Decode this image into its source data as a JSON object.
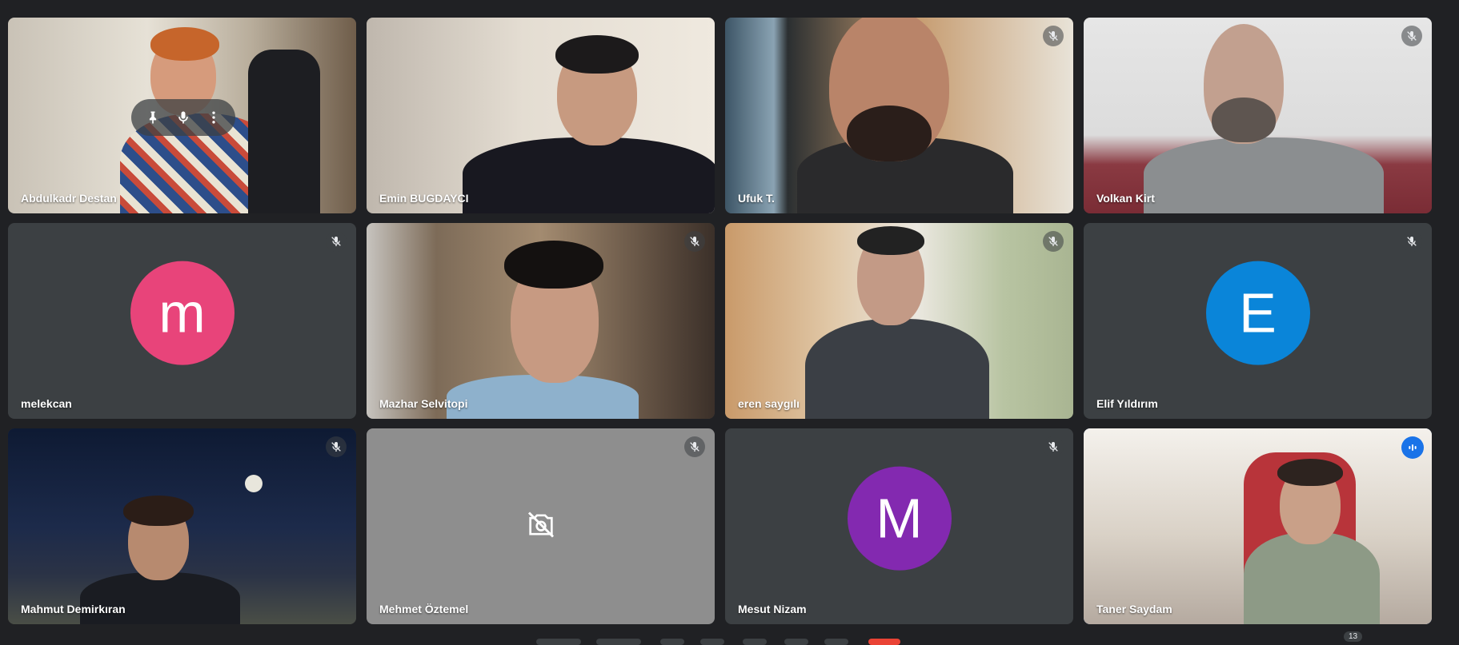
{
  "participants": [
    {
      "name": "Abdulkadr Destan"
    },
    {
      "name": "Emin BUGDAYCI"
    },
    {
      "name": "Ufuk T."
    },
    {
      "name": "Volkan Kirt"
    },
    {
      "name": "melekcan",
      "initial": "m",
      "color": "#e8447a"
    },
    {
      "name": "Mazhar Selvitopi"
    },
    {
      "name": "eren saygılı"
    },
    {
      "name": "Elif Yıldırım",
      "initial": "E",
      "color": "#0a85d9"
    },
    {
      "name": "Mahmut Demirkıran"
    },
    {
      "name": "Mehmet Öztemel"
    },
    {
      "name": "Mesut Nizam",
      "initial": "M",
      "color": "#8329b0"
    },
    {
      "name": "Taner Saydam"
    }
  ],
  "icons": {
    "muted": "mic-off-icon",
    "speaking": "audio-level-icon",
    "camera_off": "camera-off-icon",
    "pin": "pin-icon",
    "mic": "mic-icon",
    "more": "more-vert-icon"
  },
  "people_count": "13",
  "colors": {
    "background": "#202124",
    "tile": "#3c4043",
    "active_border": "#8ab4f8",
    "speaking": "#1a73e8"
  }
}
